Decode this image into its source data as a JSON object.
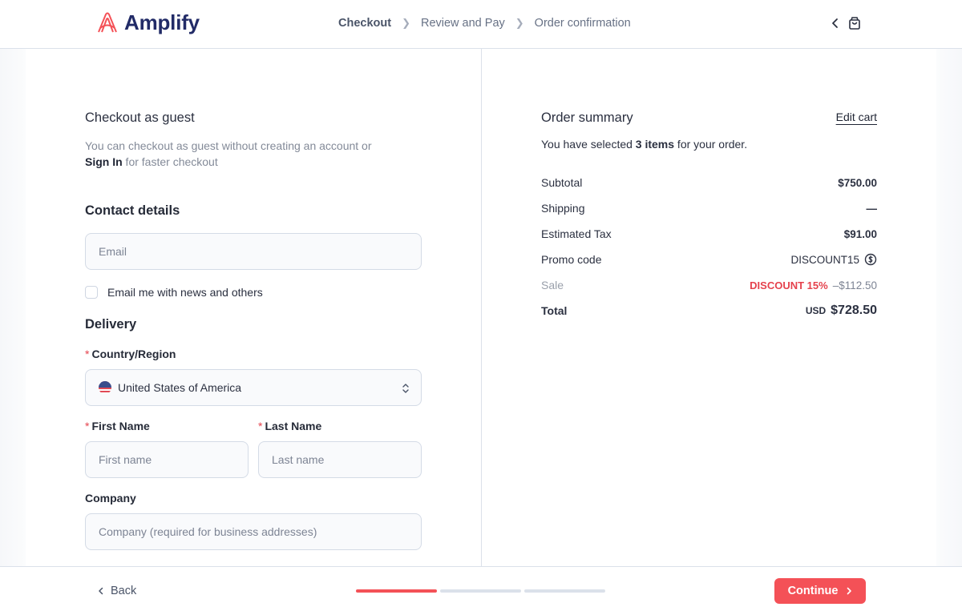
{
  "brand": {
    "name": "Amplify",
    "accent": "#f45157",
    "logo_color": "#222b67"
  },
  "breadcrumb": [
    {
      "label": "Checkout",
      "active": true
    },
    {
      "label": "Review and Pay",
      "active": false
    },
    {
      "label": "Order confirmation",
      "active": false
    }
  ],
  "header_icons": [
    "chevron-left-icon",
    "shopping-bag-icon"
  ],
  "guest": {
    "title": "Checkout as guest",
    "desc_prefix": "You can checkout as guest without creating an account or ",
    "sign_in": "Sign In",
    "desc_suffix": " for faster checkout"
  },
  "contact": {
    "title": "Contact details",
    "email_placeholder": "Email",
    "newsletter_label": "Email me with news and others",
    "newsletter_checked": false
  },
  "delivery": {
    "title": "Delivery",
    "country_label": "Country/Region",
    "country_value": "United States of America",
    "first_name_label": "First Name",
    "first_name_placeholder": "First name",
    "last_name_label": "Last Name",
    "last_name_placeholder": "Last name",
    "company_label": "Company",
    "company_placeholder": "Company (required for business addresses)",
    "required_mark": "*"
  },
  "summary": {
    "title": "Order summary",
    "edit_cart": "Edit cart",
    "items_prefix": "You have selected ",
    "items_count": "3 items",
    "items_suffix": " for your order.",
    "rows": {
      "subtotal": {
        "label": "Subtotal",
        "value": "$750.00"
      },
      "shipping": {
        "label": "Shipping",
        "value": "—"
      },
      "tax": {
        "label": "Estimated Tax",
        "value": "$91.00"
      },
      "promo": {
        "label": "Promo code",
        "value": "DISCOUNT15"
      },
      "sale": {
        "label": "Sale",
        "tag": "DISCOUNT 15%",
        "value": "–$112.50"
      },
      "total": {
        "label": "Total",
        "currency": "USD",
        "value": "$728.50"
      }
    }
  },
  "footer": {
    "back_label": "Back",
    "continue_label": "Continue",
    "progress": {
      "current_step": 1,
      "total_steps": 3
    }
  }
}
